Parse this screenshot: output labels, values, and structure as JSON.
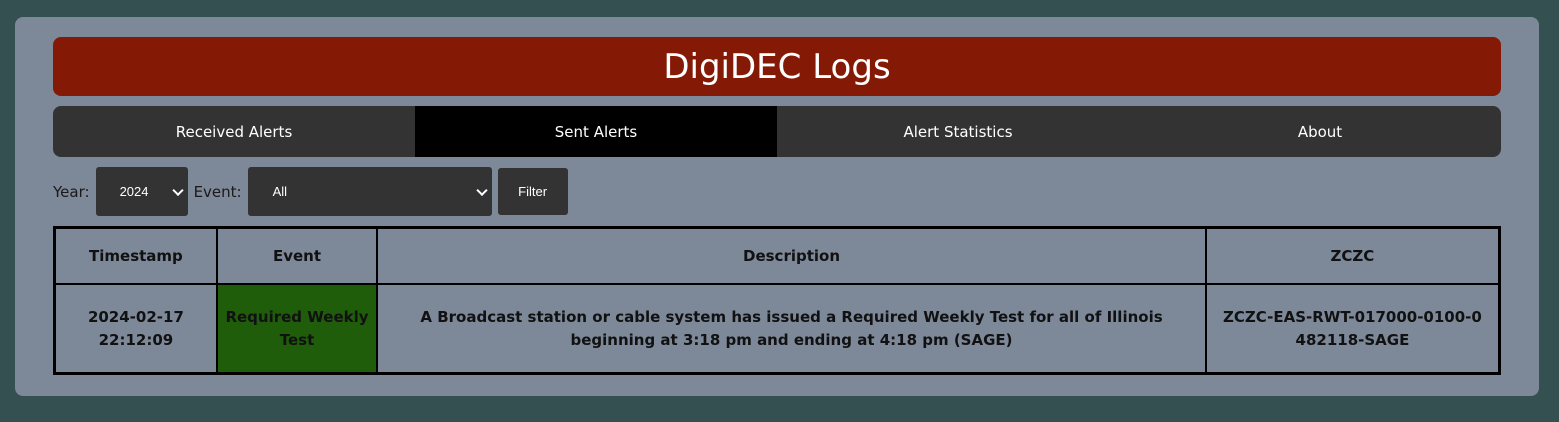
{
  "header": {
    "title": "DigiDEC Logs"
  },
  "nav": {
    "items": [
      {
        "label": "Received Alerts",
        "active": false
      },
      {
        "label": "Sent Alerts",
        "active": true
      },
      {
        "label": "Alert Statistics",
        "active": false
      },
      {
        "label": "About",
        "active": false
      }
    ]
  },
  "filters": {
    "year_label": "Year:",
    "year_value": "2024",
    "event_label": "Event:",
    "event_value": "All",
    "filter_button": "Filter"
  },
  "table": {
    "columns": [
      "Timestamp",
      "Event",
      "Description",
      "ZCZC"
    ],
    "rows": [
      {
        "timestamp": "2024-02-17 22:12:09",
        "event": "Required Weekly Test",
        "description": "A Broadcast station or cable system has issued a Required Weekly Test for all of Illinois beginning at 3:18 pm and ending at 4:18 pm (SAGE)",
        "zczc": "ZCZC-EAS-RWT-017000-0100-0482118-SAGE"
      }
    ]
  },
  "colors": {
    "background": "#345050",
    "panel": "#7d8898",
    "header": "#841a06",
    "nav": "#333333",
    "nav_active": "#000000",
    "event_rwt": "#1f5d0a"
  }
}
